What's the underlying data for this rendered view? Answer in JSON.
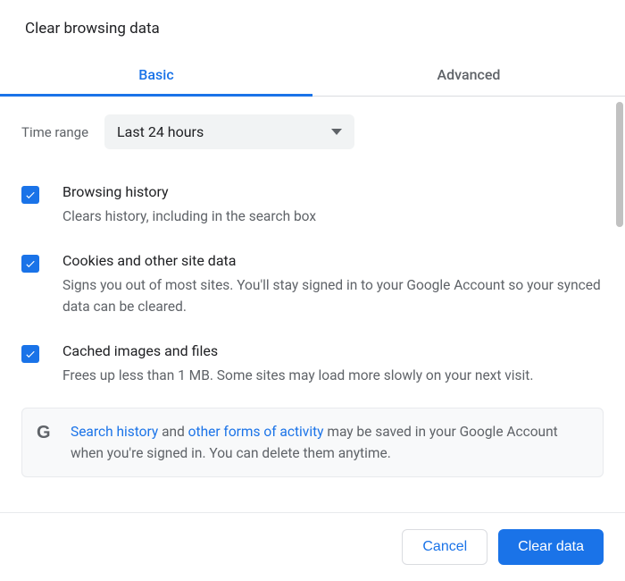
{
  "title": "Clear browsing data",
  "tabs": {
    "basic": "Basic",
    "advanced": "Advanced"
  },
  "time_range": {
    "label": "Time range",
    "value": "Last 24 hours"
  },
  "options": [
    {
      "title": "Browsing history",
      "desc": "Clears history, including in the search box",
      "checked": true
    },
    {
      "title": "Cookies and other site data",
      "desc": "Signs you out of most sites. You'll stay signed in to your Google Account so your synced data can be cleared.",
      "checked": true
    },
    {
      "title": "Cached images and files",
      "desc": "Frees up less than 1 MB. Some sites may load more slowly on your next visit.",
      "checked": true
    }
  ],
  "notice": {
    "link1": "Search history",
    "mid1": " and ",
    "link2": "other forms of activity",
    "rest": " may be saved in your Google Account when you're signed in. You can delete them anytime."
  },
  "buttons": {
    "cancel": "Cancel",
    "clear": "Clear data"
  }
}
